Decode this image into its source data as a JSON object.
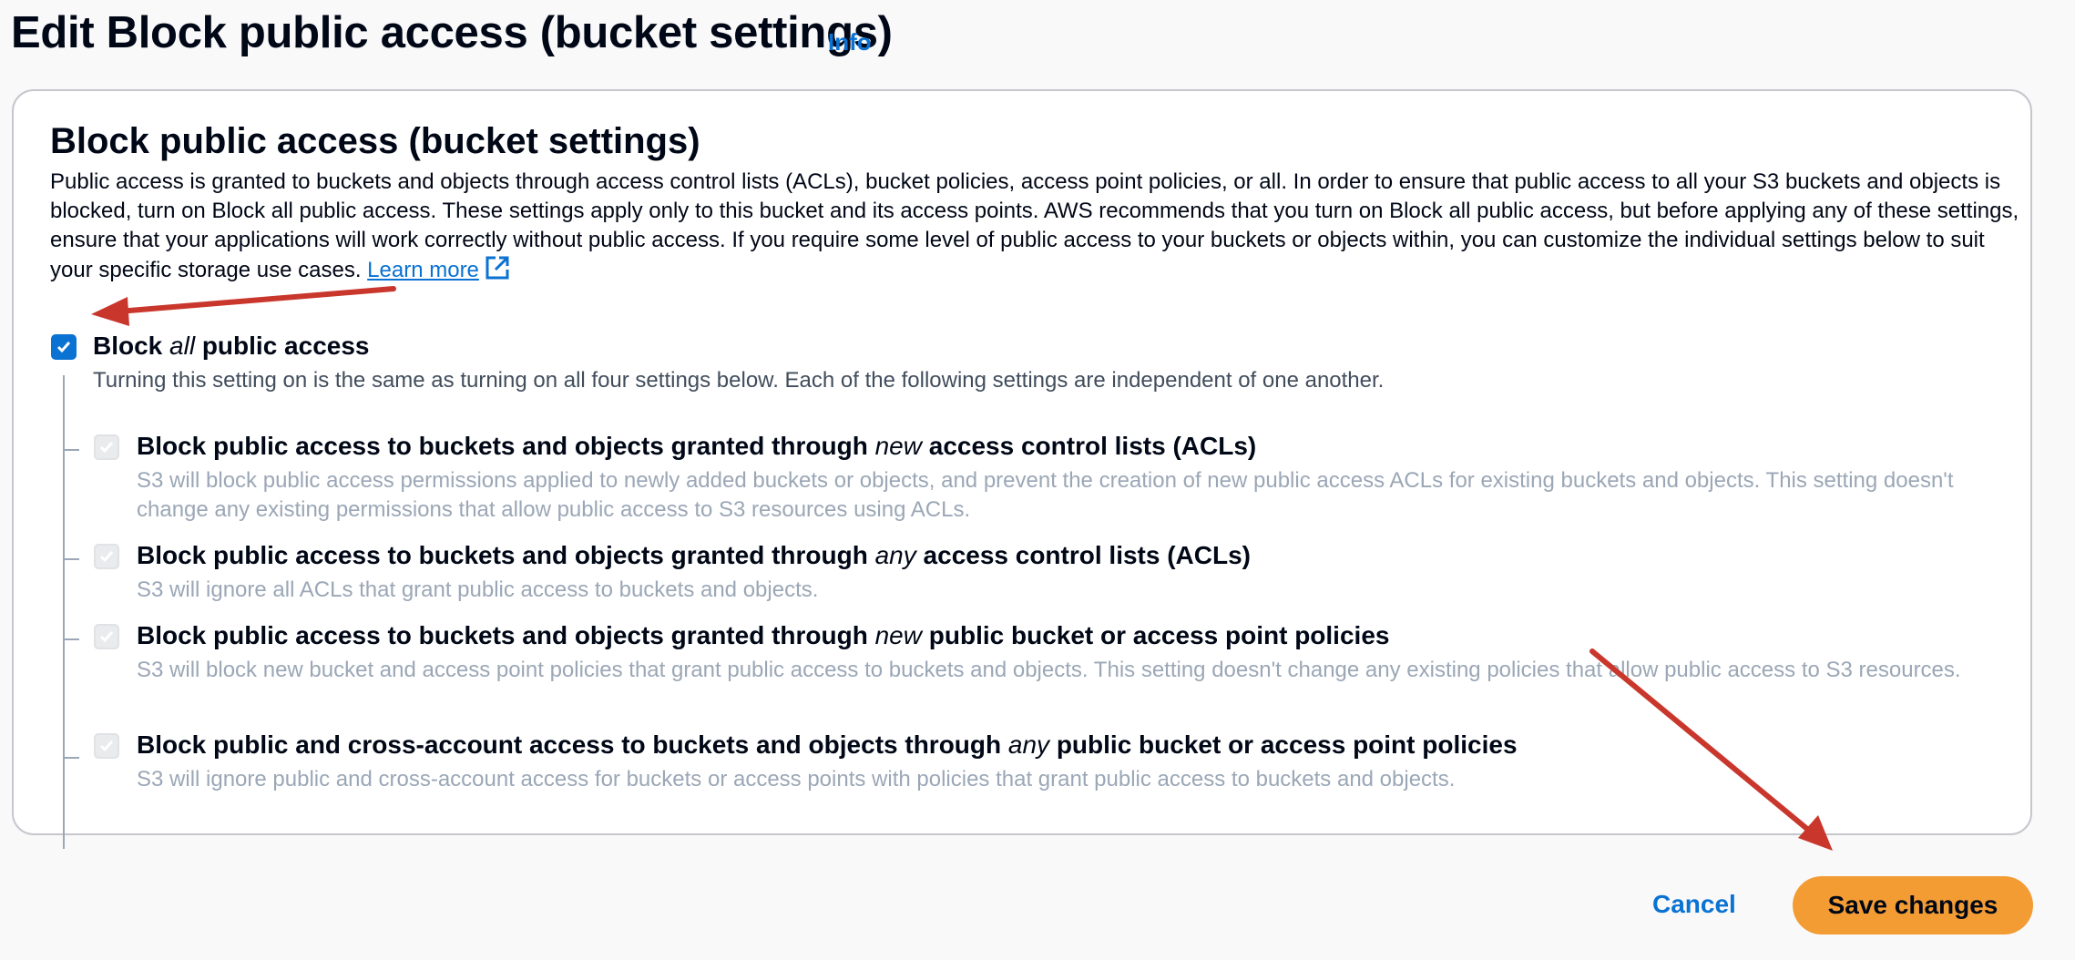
{
  "page": {
    "title": "Edit Block public access (bucket settings)",
    "info_link": "Info"
  },
  "card": {
    "title": "Block public access (bucket settings)",
    "description": "Public access is granted to buckets and objects through access control lists (ACLs), bucket policies, access point policies, or all. In order to ensure that public access to all your S3 buckets and objects is blocked, turn on Block all public access. These settings apply only to this bucket and its access points. AWS recommends that you turn on Block all public access, but before applying any of these settings, ensure that your applications will work correctly without public access. If you require some level of public access to your buckets or objects within, you can customize the individual settings below to suit your specific storage use cases.",
    "learn_more": "Learn more"
  },
  "block_all": {
    "label_pre": "Block ",
    "label_em": "all",
    "label_post": " public access",
    "checked": true,
    "description": "Turning this setting on is the same as turning on all four settings below. Each of the following settings are independent of one another."
  },
  "options": [
    {
      "label_pre": "Block public access to buckets and objects granted through ",
      "label_em": "new",
      "label_post": " access control lists (ACLs)",
      "checked": true,
      "disabled": true,
      "description": "S3 will block public access permissions applied to newly added buckets or objects, and prevent the creation of new public access ACLs for existing buckets and objects. This setting doesn't change any existing permissions that allow public access to S3 resources using ACLs."
    },
    {
      "label_pre": "Block public access to buckets and objects granted through ",
      "label_em": "any",
      "label_post": " access control lists (ACLs)",
      "checked": true,
      "disabled": true,
      "description": "S3 will ignore all ACLs that grant public access to buckets and objects."
    },
    {
      "label_pre": "Block public access to buckets and objects granted through ",
      "label_em": "new",
      "label_post": " public bucket or access point policies",
      "checked": true,
      "disabled": true,
      "description": "S3 will block new bucket and access point policies that grant public access to buckets and objects. This setting doesn't change any existing policies that allow public access to S3 resources."
    },
    {
      "label_pre": "Block public and cross-account access to buckets and objects through ",
      "label_em": "any",
      "label_post": " public bucket or access point policies",
      "checked": true,
      "disabled": true,
      "description": "S3 will ignore public and cross-account access for buckets or access points with policies that grant public access to buckets and objects."
    }
  ],
  "actions": {
    "cancel": "Cancel",
    "save": "Save changes"
  },
  "colors": {
    "link": "#0972d3",
    "primary_button": "#f39c34",
    "annotation_arrow": "#c9372c"
  },
  "icons": {
    "learn_more": "external-link-icon",
    "checkbox": "checkmark-icon"
  }
}
